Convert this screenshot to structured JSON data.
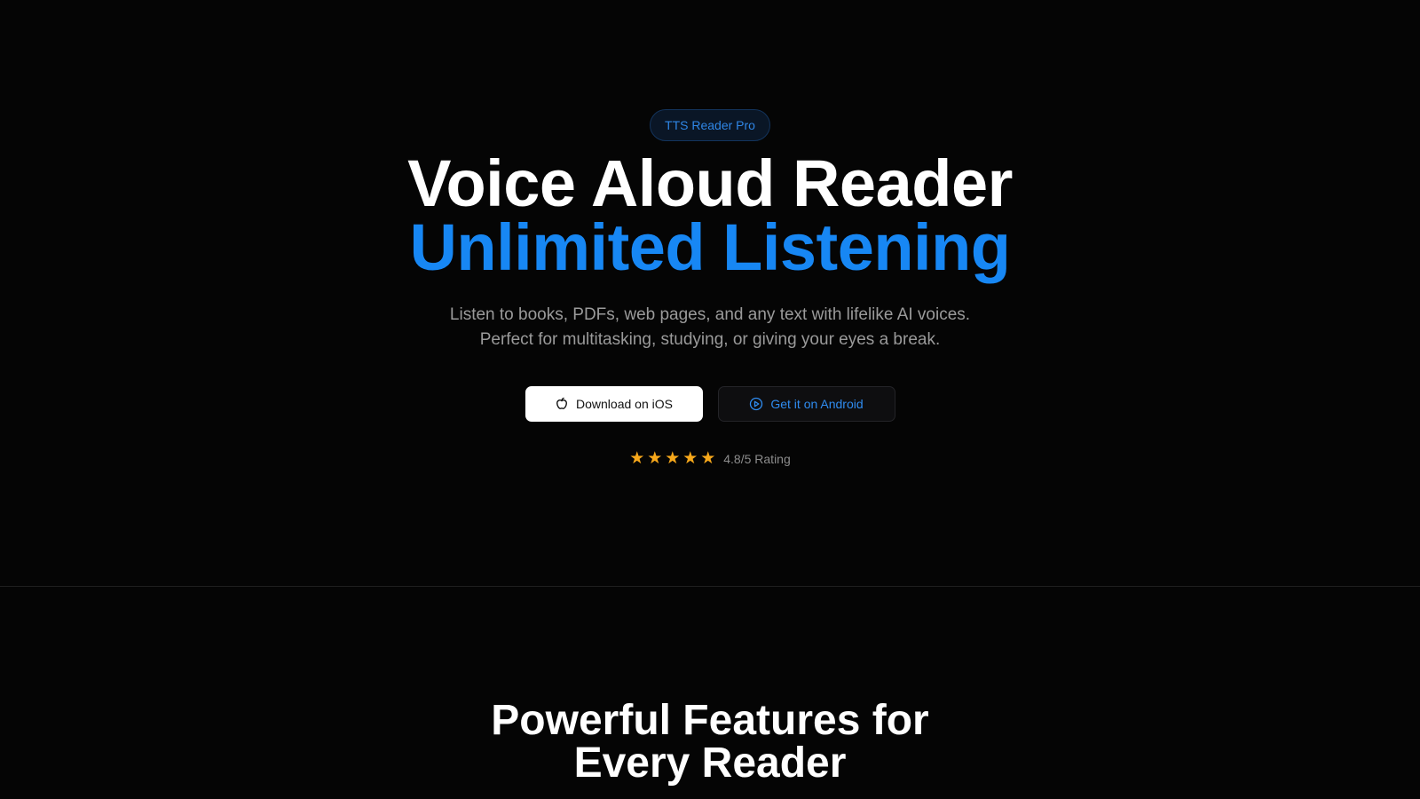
{
  "hero": {
    "badge": "TTS Reader Pro",
    "headline_line1": "Voice Aloud Reader",
    "headline_line2": "Unlimited Listening",
    "subtitle_line1": "Listen to books, PDFs, web pages, and any text with lifelike AI voices.",
    "subtitle_line2": "Perfect for multitasking, studying, or giving your eyes a break.",
    "ios_button_label": "Download on iOS",
    "ios_button_icon": "apple-icon",
    "android_button_label": "Get it on Android",
    "android_button_icon": "play-icon",
    "rating_value": 4.8,
    "rating_max": 5,
    "rating_text": "4.8/5 Rating"
  },
  "features": {
    "title_line1": "Powerful Features for",
    "title_line2": "Every Reader"
  },
  "colors": {
    "background": "#050505",
    "accent_blue": "#1787f4",
    "star_color": "#f7a81b",
    "badge_border": "#13345c"
  }
}
